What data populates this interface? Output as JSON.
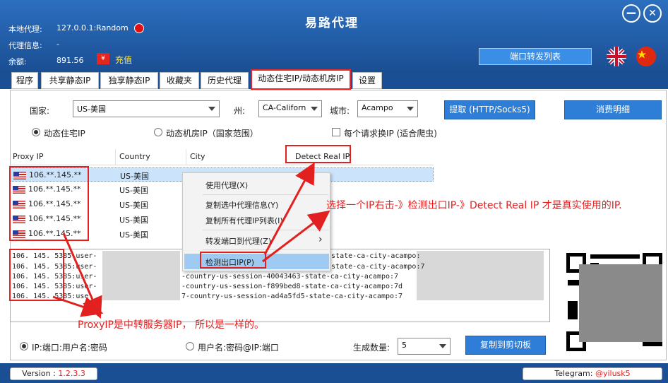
{
  "app": {
    "title": "易路代理"
  },
  "window": {
    "minimize": "−",
    "close": "✕"
  },
  "info": {
    "local_proxy_label": "本地代理:",
    "local_proxy_value": "127.0.0.1:Random",
    "proxy_info_label": "代理信息:",
    "proxy_info_value": "-",
    "balance_label": "余额:",
    "balance_value": "891.56",
    "coin_symbol": "¥",
    "recharge": "充值"
  },
  "header": {
    "port_forward_button": "端口转发列表"
  },
  "tabs": [
    "程序",
    "共享静态IP",
    "独享静态IP",
    "收藏夹",
    "历史代理",
    "动态住宅IP/动态机房IP",
    "设置"
  ],
  "filters": {
    "country_label": "国家:",
    "country_value": "US-美国",
    "state_label": "州:",
    "state_value": "CA-Californ",
    "city_label": "城市:",
    "city_value": "Acampo",
    "extract_button": "提取 (HTTP/Socks5)",
    "billing_button": "消费明细",
    "residential_radio": "动态住宅IP",
    "datacenter_radio": "动态机房IP（国家范围）",
    "rotate_checkbox": "每个请求换IP (适合爬虫)"
  },
  "grid": {
    "headers": [
      "Proxy IP",
      "Country",
      "City",
      "Detect Real IP"
    ],
    "rows": [
      {
        "ip": "106.**.145.**",
        "country": "US-美国"
      },
      {
        "ip": "106.**.145.**",
        "country": "US-美国"
      },
      {
        "ip": "106.**.145.**",
        "country": "US-美国"
      },
      {
        "ip": "106.**.145.**",
        "country": "US-美国"
      },
      {
        "ip": "106.**.145.**",
        "country": "US-美国"
      }
    ]
  },
  "context_menu": {
    "items": [
      "使用代理(X)",
      "复制选中代理信息(Y)",
      "复制所有代理IP列表(I)",
      "转发端口到代理(Z)",
      "检测出口IP(P)"
    ],
    "submenu_arrow": "›"
  },
  "output": {
    "lines_left": [
      "106.",
      "106.",
      "106.",
      "106.",
      "106."
    ],
    "lines_left_mid": [
      "145.",
      "145.",
      "145.",
      "145.",
      "145."
    ],
    "lines_mid": [
      "5385:user-",
      "5385:user-",
      "5385:user-",
      "5385:user-",
      "5385:use"
    ],
    "lines_right": [
      "8-state-ca-city-acampo:",
      "3-state-ca-city-acampo:7",
      "-country-us-session-40043463-state-ca-city-acampo:7",
      "-country-us-session-f899bed8-state-ca-city-acampo:7d",
      "7-country-us-session-ad4a5fd5-state-ca-city-acampo:7"
    ]
  },
  "annotations": {
    "right_note": "选择一个IP右击-》检测出口IP-》Detect Real IP 才是真实使用的IP.",
    "bottom_note": "ProxyIP是中转服务器IP， 所以是一样的。"
  },
  "bottom": {
    "format1": "IP:端口:用户名:密码",
    "format2": "用户名:密码@IP:端口",
    "count_label": "生成数量:",
    "count_value": "5",
    "copy_button": "复制到剪切板"
  },
  "status": {
    "version_label": "Version : ",
    "version_value": "1.2.3.3",
    "telegram_label": "Telegram: ",
    "telegram_value": "@yilusk5"
  },
  "colors": {
    "header": "#1b4f94",
    "accent": "#2e7ed8",
    "annotation": "#e32020"
  }
}
